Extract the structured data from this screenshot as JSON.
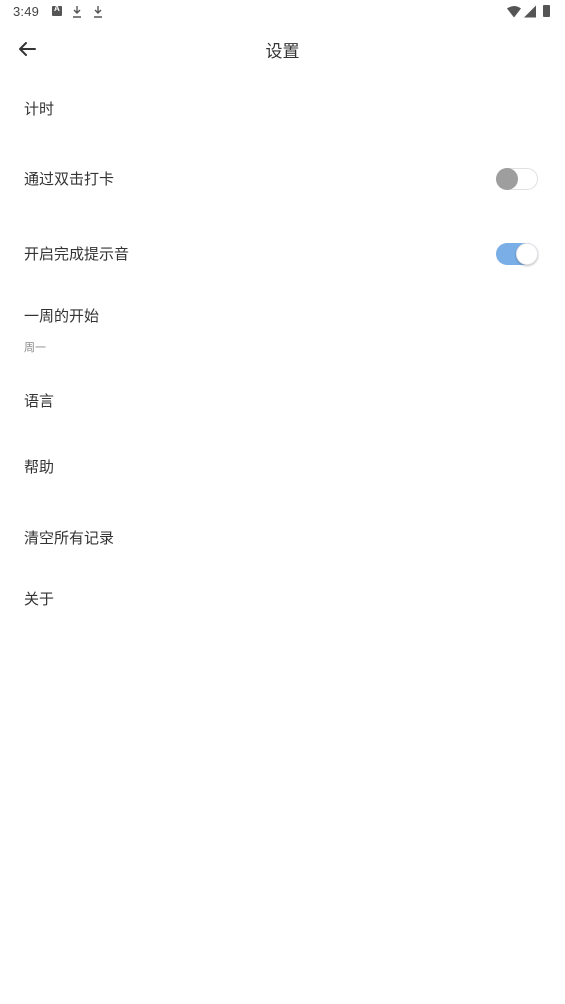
{
  "status_bar": {
    "time": "3:49",
    "icons": [
      "a-icon",
      "download-icon",
      "download-icon",
      "wifi-icon",
      "signal-icon",
      "battery-icon"
    ]
  },
  "app_bar": {
    "back_icon": "arrow-left-icon",
    "title": "设置"
  },
  "settings": {
    "timer": {
      "label": "计时"
    },
    "double_tap_checkin": {
      "label": "通过双击打卡",
      "enabled": false
    },
    "completion_sound": {
      "label": "开启完成提示音",
      "enabled": true
    },
    "week_start": {
      "label": "一周的开始",
      "value": "周一"
    },
    "language": {
      "label": "语言"
    },
    "help": {
      "label": "帮助"
    },
    "clear_records": {
      "label": "清空所有记录"
    },
    "about": {
      "label": "关于"
    }
  },
  "colors": {
    "toggle_on": "#7aaee6",
    "toggle_off_thumb": "#9e9e9e",
    "text_primary": "#333333",
    "text_secondary": "#888888"
  }
}
